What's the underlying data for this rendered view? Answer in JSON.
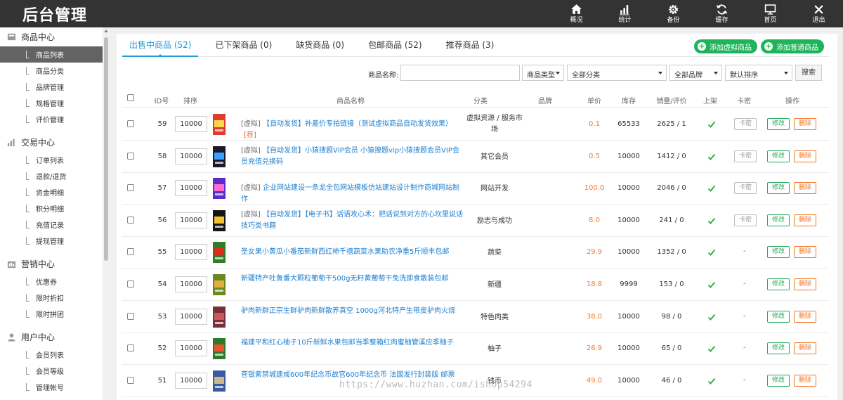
{
  "app": {
    "title": "后台管理",
    "topnav": [
      {
        "label": "概况",
        "icon": "home-icon"
      },
      {
        "label": "统计",
        "icon": "bar-chart-icon"
      },
      {
        "label": "备份",
        "icon": "gear-icon"
      },
      {
        "label": "缓存",
        "icon": "refresh-icon"
      },
      {
        "label": "首页",
        "icon": "monitor-icon"
      },
      {
        "label": "退出",
        "icon": "close-icon"
      }
    ]
  },
  "sidebar": {
    "groups": [
      {
        "title": "商品中心",
        "icon": "goods-icon",
        "items": [
          "商品列表",
          "商品分类",
          "品牌管理",
          "规格管理",
          "评价管理"
        ],
        "active": 0
      },
      {
        "title": "交易中心",
        "icon": "trade-chart-icon",
        "items": [
          "订单列表",
          "退款/退货",
          "资金明细",
          "积分明细",
          "充值记录",
          "提现管理"
        ],
        "active": -1
      },
      {
        "title": "营销中心",
        "icon": "marketing-icon",
        "items": [
          "优惠券",
          "限时折扣",
          "限时拼团"
        ],
        "active": -1
      },
      {
        "title": "用户中心",
        "icon": "user-icon",
        "items": [
          "会员列表",
          "会员等级",
          "管理帐号"
        ],
        "active": -1
      }
    ]
  },
  "tabs": [
    {
      "label": "出售中商品 (52)",
      "active": true
    },
    {
      "label": "已下架商品 (0)",
      "active": false
    },
    {
      "label": "缺货商品 (0)",
      "active": false
    },
    {
      "label": "包邮商品 (52)",
      "active": false
    },
    {
      "label": "推荐商品 (3)",
      "active": false
    }
  ],
  "actions": {
    "add_virtual": "添加虚拟商品",
    "add_normal": "添加普通商品"
  },
  "filters": {
    "name_label": "商品名称:",
    "name_value": "",
    "type_select": "商品类型",
    "category_select": "全部分类",
    "brand_select": "全部品牌",
    "sort_select": "默认排序",
    "search_button": "搜索"
  },
  "table": {
    "headers": {
      "id": "ID号",
      "sort": "排序",
      "name": "商品名称",
      "category": "分类",
      "brand": "品牌",
      "price": "单价",
      "stock": "库存",
      "sales": "销量/评价",
      "onsale": "上架",
      "card": "卡密",
      "ops": "操作"
    },
    "buttons": {
      "card": "卡密",
      "edit": "修改",
      "delete": "删除"
    },
    "rows": [
      {
        "id": "59",
        "sort": "10000",
        "tag": "[虚拟]",
        "name": "【自动发货】补差价专拍链接（测试虚拟商品自动发货效果）",
        "rec": "[荐]",
        "category": "虚拟资源 / 服务市场",
        "brand": "",
        "price": "0.1",
        "stock": "65533",
        "sales": "2625 / 1",
        "card": true,
        "img": "#e23b2e",
        "img2": "#ffd84a"
      },
      {
        "id": "58",
        "sort": "10000",
        "tag": "[虚拟]",
        "name": "【自动发货】小猿搜题VIP会员 小猿搜题vip小猿搜题会员VIP会员充值兑换码",
        "rec": "",
        "category": "其它会员",
        "brand": "",
        "price": "0.5",
        "stock": "10000",
        "sales": "1412 / 0",
        "card": true,
        "img": "#1a1a2e",
        "img2": "#3aa0ff"
      },
      {
        "id": "57",
        "sort": "10000",
        "tag": "[虚拟]",
        "name": "企业网站建设一条龙全包网站模板仿站建站设计制作商城网站制作",
        "rec": "",
        "category": "网站开发",
        "brand": "",
        "price": "100.0",
        "stock": "10000",
        "sales": "2046 / 0",
        "card": true,
        "img": "#5b2bd1",
        "img2": "#ff6bd2"
      },
      {
        "id": "56",
        "sort": "10000",
        "tag": "[虚拟]",
        "name": "【自动发货】【电子书】话语攻心术：把话说到对方的心坎里说话技巧类书籍",
        "rec": "",
        "category": "励志与成功",
        "brand": "",
        "price": "8.0",
        "stock": "10000",
        "sales": "241 / 0",
        "card": true,
        "img": "#151515",
        "img2": "#f2c230"
      },
      {
        "id": "55",
        "sort": "10000",
        "tag": "",
        "name": "圣女果小黄瓜小番茄新鲜西红柿千禧蔬菜水果助农净重5斤顺丰包邮",
        "rec": "",
        "category": "蔬菜",
        "brand": "",
        "price": "29.9",
        "stock": "10000",
        "sales": "1352 / 0",
        "card": false,
        "img": "#2f7d25",
        "img2": "#d6301e"
      },
      {
        "id": "54",
        "sort": "10000",
        "tag": "",
        "name": "新疆特产吐鲁番大颗粒葡萄干500g无籽黄葡萄干免洗即食散装包邮",
        "rec": "",
        "category": "新疆",
        "brand": "",
        "price": "18.8",
        "stock": "9999",
        "sales": "153 / 0",
        "card": false,
        "img": "#6b8a1e",
        "img2": "#e0b13a"
      },
      {
        "id": "53",
        "sort": "10000",
        "tag": "",
        "name": "驴肉新鲜正宗生鲜驴肉新鲜散养真空 1000g河北特产生带皮驴肉火烧",
        "rec": "",
        "category": "特色肉类",
        "brand": "",
        "price": "38.0",
        "stock": "10000",
        "sales": "98 / 0",
        "card": false,
        "img": "#7a2f3a",
        "img2": "#c85a5a"
      },
      {
        "id": "52",
        "sort": "10000",
        "tag": "",
        "name": "福建平和红心柚子10斤新鲜水果包邮当季整箱红肉蜜柚管溪应季柚子",
        "rec": "",
        "category": "柚子",
        "brand": "",
        "price": "26.9",
        "stock": "10000",
        "sales": "65 / 0",
        "card": false,
        "img": "#2d7a2a",
        "img2": "#e8552c"
      },
      {
        "id": "51",
        "sort": "10000",
        "tag": "",
        "name": "苍银紫禁城建成600年纪念币故宫600年纪念币 法国发行封装版 邮票",
        "rec": "",
        "category": "钱币",
        "brand": "",
        "price": "49.0",
        "stock": "10000",
        "sales": "46 / 0",
        "card": false,
        "img": "#3a5aa0",
        "img2": "#c9b890"
      }
    ]
  },
  "watermark": "https://www.huzhan.com/ishop54294"
}
